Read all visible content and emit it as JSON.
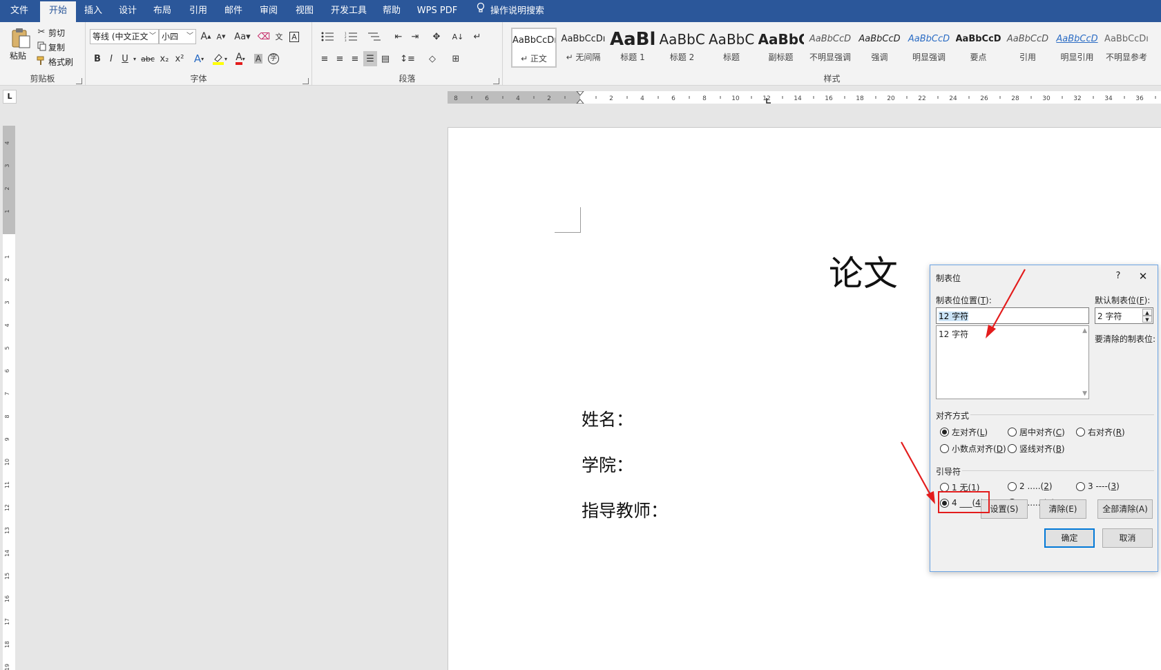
{
  "tabs": {
    "file": "文件",
    "home": "开始",
    "insert": "插入",
    "design": "设计",
    "layout": "布局",
    "references": "引用",
    "mailings": "邮件",
    "review": "审阅",
    "view": "视图",
    "developer": "开发工具",
    "help": "帮助",
    "wps_pdf": "WPS PDF",
    "tell_me": "操作说明搜索"
  },
  "clipboard": {
    "paste": "粘贴",
    "cut": "剪切",
    "copy": "复制",
    "format_painter": "格式刷",
    "label": "剪贴板"
  },
  "font": {
    "name": "等线 (中文正文",
    "size": "小四",
    "label": "字体",
    "bold": "B",
    "italic": "I",
    "underline": "U",
    "strike": "abc",
    "sub": "x₂",
    "sup": "x²",
    "change_case": "Aa",
    "grow": "A",
    "shrink": "A",
    "phonetic": "文",
    "border_char": "A",
    "shade_char": "A",
    "enclose": "字",
    "effects": "A",
    "font_color": "A"
  },
  "paragraph": {
    "label": "段落"
  },
  "styles": {
    "label": "样式",
    "items": [
      {
        "sample": "AaBbCcDı",
        "name": "↵ 正文"
      },
      {
        "sample": "AaBbCcDı",
        "name": "↵ 无间隔"
      },
      {
        "sample": "AaBl",
        "name": "标题 1"
      },
      {
        "sample": "AaBbC",
        "name": "标题 2"
      },
      {
        "sample": "AaBbC",
        "name": "标题"
      },
      {
        "sample": "AaBbC",
        "name": "副标题"
      },
      {
        "sample": "AaBbCcD",
        "name": "不明显强调"
      },
      {
        "sample": "AaBbCcD",
        "name": "强调"
      },
      {
        "sample": "AaBbCcD",
        "name": "明显强调"
      },
      {
        "sample": "AaBbCcD",
        "name": "要点"
      },
      {
        "sample": "AaBbCcD",
        "name": "引用"
      },
      {
        "sample": "AaBbCcD",
        "name": "明显引用"
      },
      {
        "sample": "AaBbCcDı",
        "name": "不明显参考"
      }
    ]
  },
  "ruler": {
    "h_labels_left": [
      "8",
      "6",
      "4",
      "2"
    ],
    "h_labels_right": [
      "2",
      "4",
      "6",
      "8",
      "10",
      "12",
      "14",
      "16",
      "18",
      "20",
      "22",
      "24",
      "26",
      "28",
      "30",
      "32",
      "34",
      "36"
    ],
    "v_labels_top": [
      "4",
      "3",
      "2",
      "1"
    ],
    "v_labels": [
      "1",
      "2",
      "3",
      "4",
      "5",
      "6",
      "7",
      "8",
      "9",
      "10",
      "11",
      "12",
      "13",
      "14",
      "15",
      "16",
      "17",
      "18",
      "19"
    ],
    "tab_selector": "L"
  },
  "document": {
    "title": "论文",
    "lines": [
      "姓名：",
      "学院：",
      "指导教师："
    ]
  },
  "dialog": {
    "title": "制表位",
    "help": "?",
    "close": "✕",
    "tab_position_label": "制表位位置(",
    "tab_position_key": "T",
    "tab_position_value": "12 字符",
    "tab_list": [
      "12 字符"
    ],
    "default_label": "默认制表位(",
    "default_key": "F",
    "default_value": "2 字符",
    "clear_label": "要清除的制表位:",
    "alignment_label": "对齐方式",
    "alignment_options": [
      {
        "label": "左对齐(",
        "key": "L",
        "checked": true
      },
      {
        "label": "居中对齐(",
        "key": "C",
        "checked": false
      },
      {
        "label": "右对齐(",
        "key": "R",
        "checked": false
      },
      {
        "label": "小数点对齐(",
        "key": "D",
        "checked": false
      },
      {
        "label": "竖线对齐(",
        "key": "B",
        "checked": false
      }
    ],
    "leader_label": "引导符",
    "leader_options": [
      {
        "label": "1 无(",
        "key": "1",
        "checked": false
      },
      {
        "label": "2 .....(",
        "key": "2",
        "checked": false
      },
      {
        "label": "3 ----(",
        "key": "3",
        "checked": false
      },
      {
        "label": "4 ___(",
        "key": "4",
        "checked": true
      },
      {
        "label": "5 ......(",
        "key": "5",
        "checked": false
      }
    ],
    "set_button": "设置(S)",
    "clear_button": "清除(E)",
    "clear_all_button": "全部清除(A)",
    "ok_button": "确定",
    "cancel_button": "取消"
  },
  "colors": {
    "title_bar": "#2b579a",
    "ribbon": "#f3f3f3",
    "annotation_red": "#e31c1c",
    "dialog_border": "#6aa3e3"
  }
}
